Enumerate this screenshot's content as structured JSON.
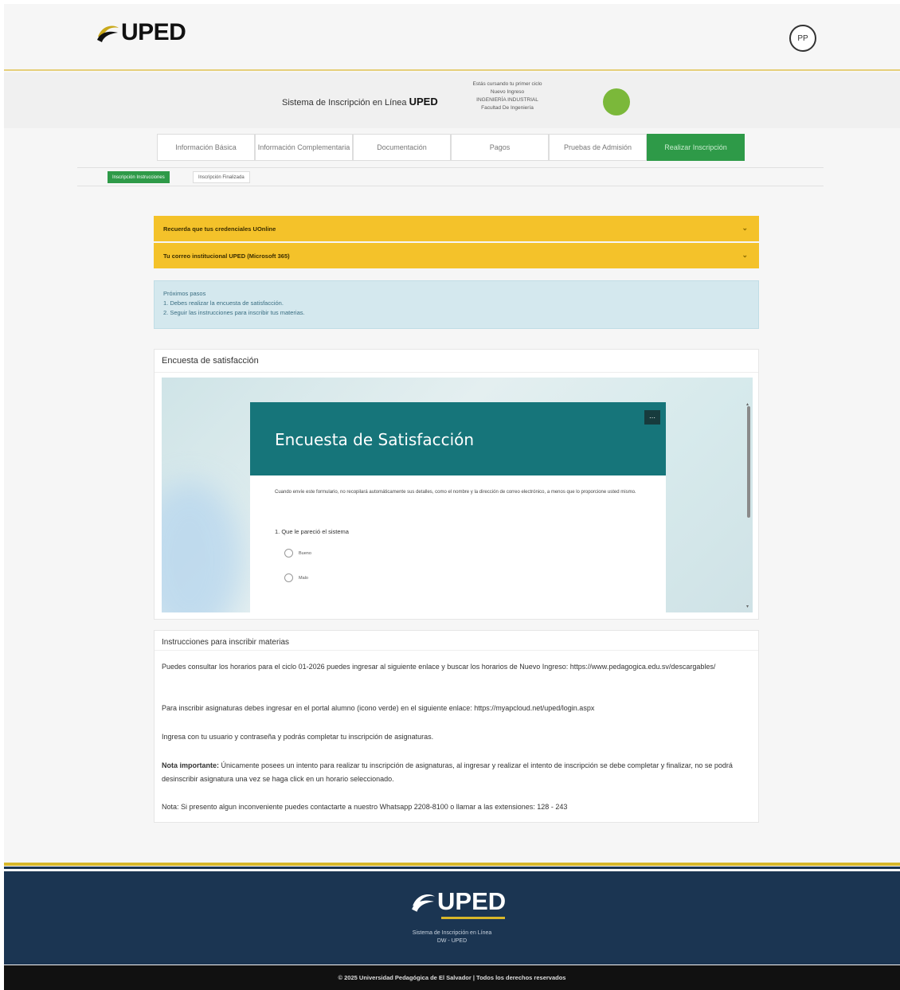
{
  "header": {
    "logo_text": "UPED",
    "avatar_initials": "PP",
    "system_title_prefix": "Sistema de Inscripción en Línea",
    "system_title_brand": "UPED",
    "student_lines": [
      "Estás cursando tu primer ciclo",
      "Nuevo Ingreso",
      "INGENIERÍA INDUSTRIAL",
      "Facultad De Ingeniería"
    ],
    "status_color": "#7bb83a"
  },
  "tabs": [
    {
      "label": "Información Básica"
    },
    {
      "label": "Información Complementaria"
    },
    {
      "label": "Documentación"
    },
    {
      "label": "Pagos"
    },
    {
      "label": "Pruebas de Admisión"
    },
    {
      "label": "Realizar Inscripción"
    }
  ],
  "subtabs": [
    {
      "label": "Inscripción Instrucciones"
    },
    {
      "label": "Inscripción Finalizada"
    }
  ],
  "accordions": [
    {
      "label": "Recuerda que tus credenciales UOnline"
    },
    {
      "label": "Tu correo institucional UPED (Microsoft 365)"
    }
  ],
  "next_steps": {
    "title": "Próximos pasos",
    "items": [
      "1. Debes realizar la encuesta de satisfacción.",
      "2. Seguir las instrucciones para inscribir tus materias."
    ]
  },
  "survey": {
    "card_title": "Encuesta de satisfacción",
    "form_title": "Encuesta de Satisfacción",
    "notice": "Cuando envíe este formulario, no recopilará automáticamente sus detalles, como el nombre y la dirección de correo electrónico, a menos que lo proporcione usted mismo.",
    "question": "1. Que le pareció el sistema",
    "options": [
      "Bueno",
      "Malo"
    ]
  },
  "instructions": {
    "title": "Instrucciones para inscribir materias",
    "p1": "Puedes consultar los horarios para el ciclo 01-2026 puedes ingresar al siguiente enlace y buscar los horarios de Nuevo Ingreso: https://www.pedagogica.edu.sv/descargables/",
    "p2": "Para inscribir asignaturas debes ingresar en el  portal alumno (icono verde) en el siguiente enlace: https://myapcloud.net/uped/login.aspx",
    "p3": "Ingresa con tu usuario y contraseña y podrás completar tu inscripción de asignaturas.",
    "p4_label": "Nota importante:",
    "p4": " Únicamente posees un intento para realizar tu inscripción de asignaturas, al ingresar y realizar el intento de inscripción se debe completar y finalizar, no se podrá desinscribir asignatura una vez se haga click en un horario seleccionado.",
    "p5": "Nota: Si presento algun inconveniente puedes contactarte a nuestro Whatsapp 2208-8100 o llamar a las extensiones: 128 - 243"
  },
  "footer": {
    "logo_text": "UPED",
    "line1": "Sistema de Inscripción en Línea",
    "line2": "DW - UPED",
    "copyright": "© 2025 Universidad Pedagógica de El Salvador | Todos los derechos reservados"
  },
  "colors": {
    "accent_green": "#2e9a48",
    "accordion_yellow": "#f4c22a",
    "form_teal": "#16757a",
    "footer_navy": "#1b3552"
  }
}
